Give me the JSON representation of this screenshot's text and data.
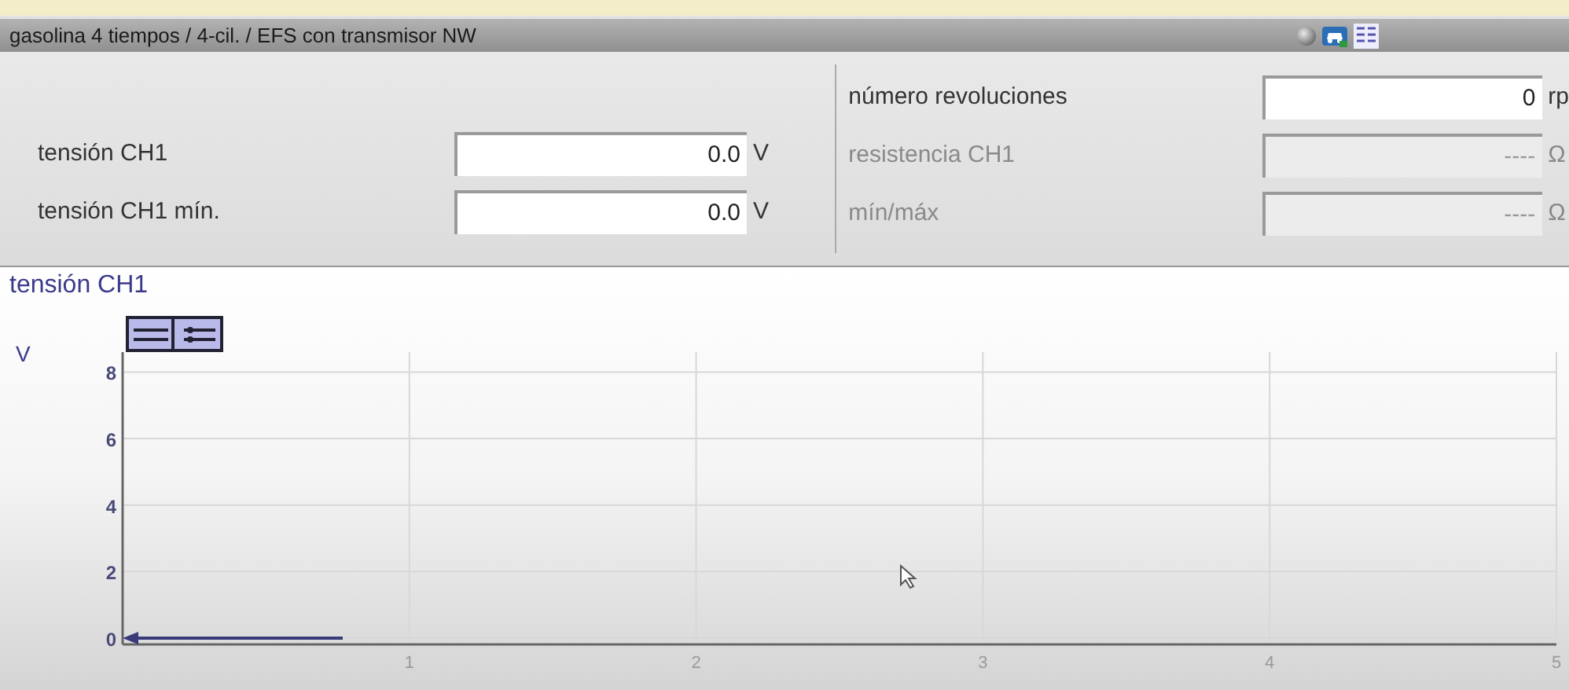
{
  "title_bar": {
    "title": "gasolina 4 tiempos /  4-cil. / EFS con transmisor NW"
  },
  "left_readings": [
    {
      "label": "tensión CH1",
      "value": "0.0",
      "unit": "V",
      "disabled": false
    },
    {
      "label": "tensión CH1 mín.",
      "value": "0.0",
      "unit": "V",
      "disabled": false
    }
  ],
  "right_readings": [
    {
      "label": "número revoluciones",
      "value": "0",
      "unit": "rp",
      "disabled": false
    },
    {
      "label": "resistencia CH1",
      "value": "----",
      "unit": "Ω",
      "disabled": true
    },
    {
      "label": "mín/máx",
      "value": "----",
      "unit": "Ω",
      "disabled": true
    }
  ],
  "chart": {
    "chart_data": {
      "type": "line",
      "title": "tensión CH1",
      "ylabel": "V",
      "xlim": [
        0,
        5
      ],
      "ylim": [
        0,
        8.6
      ],
      "xticks": [
        1,
        2,
        3,
        4,
        5
      ],
      "yticks": [
        0,
        2,
        4,
        6,
        8
      ],
      "grid": true
    }
  }
}
